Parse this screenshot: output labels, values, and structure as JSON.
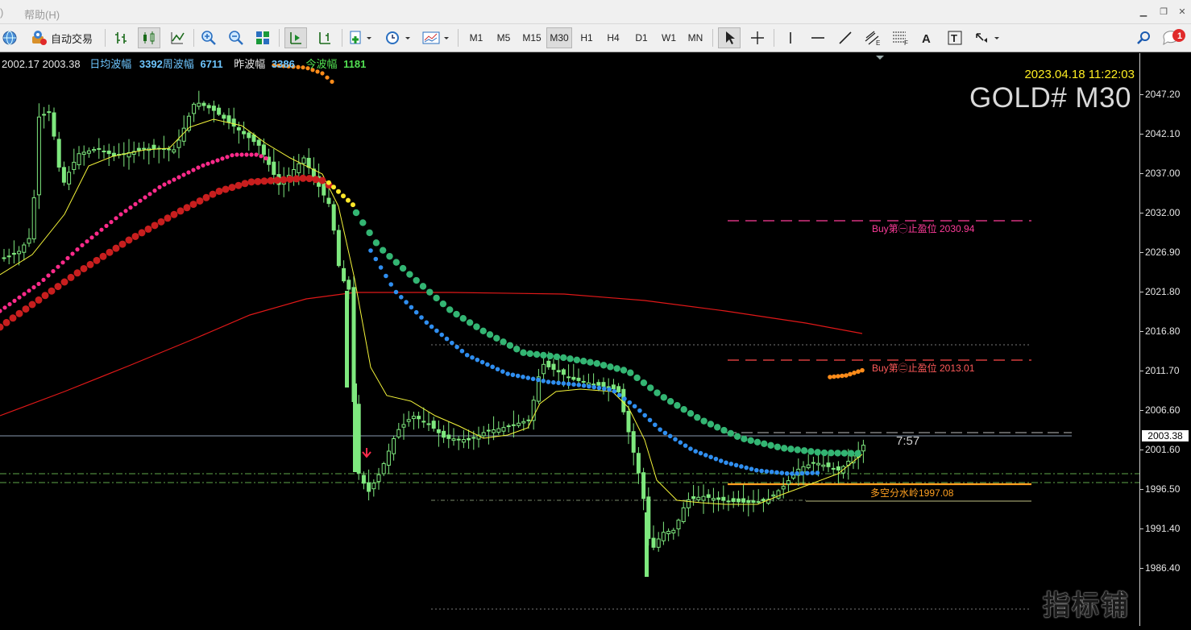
{
  "menu": {
    "items": [
      ")",
      "帮助(H)"
    ]
  },
  "toolbar": {
    "auto_trade_label": "自动交易",
    "timeframes": [
      "M1",
      "M5",
      "M15",
      "M30",
      "H1",
      "H4",
      "D1",
      "W1",
      "MN"
    ],
    "active_timeframe": "M30",
    "notification_count": "1"
  },
  "chart": {
    "info": {
      "prices": "2002.17 2003.38",
      "daily_avg_label": "日均波幅",
      "daily_avg_value": "3392",
      "weekly_label": "周波幅",
      "weekly_value": "6711",
      "yesterday_label": "昨波幅",
      "yesterday_value": "3386",
      "today_label": "今波幅",
      "today_value": "1181"
    },
    "datetime": "2023.04.18 11:22:03",
    "symbol": "GOLD# M30",
    "current_price": "2003.38",
    "countdown": "7:57",
    "price_axis": [
      "2047.20",
      "2042.10",
      "2037.00",
      "2032.00",
      "2026.90",
      "2021.80",
      "2016.80",
      "2011.70",
      "2006.60",
      "2001.60",
      "1996.50",
      "1991.40",
      "1986.40"
    ],
    "levels": [
      {
        "label": "Buy第㊀止盈位 2030.94",
        "color": "#ff3c9a"
      },
      {
        "label": "Buy第㊁止盈位 2013.01",
        "color": "#ff5a5a"
      },
      {
        "label": "多空分水岭1997.08",
        "color": "#ffa020"
      }
    ],
    "colors": {
      "bull": "#7ee87e",
      "bear": "#7ee87e",
      "ma_red": "#e01818",
      "dots_dark_red": "#c81e1e",
      "dots_pink": "#ff2a8a",
      "dots_green": "#33b573",
      "dots_blue": "#2f8ef0",
      "dots_orange": "#ff8c1a",
      "ma_yellow": "#f5f53a"
    }
  },
  "watermark": "指标铺"
}
